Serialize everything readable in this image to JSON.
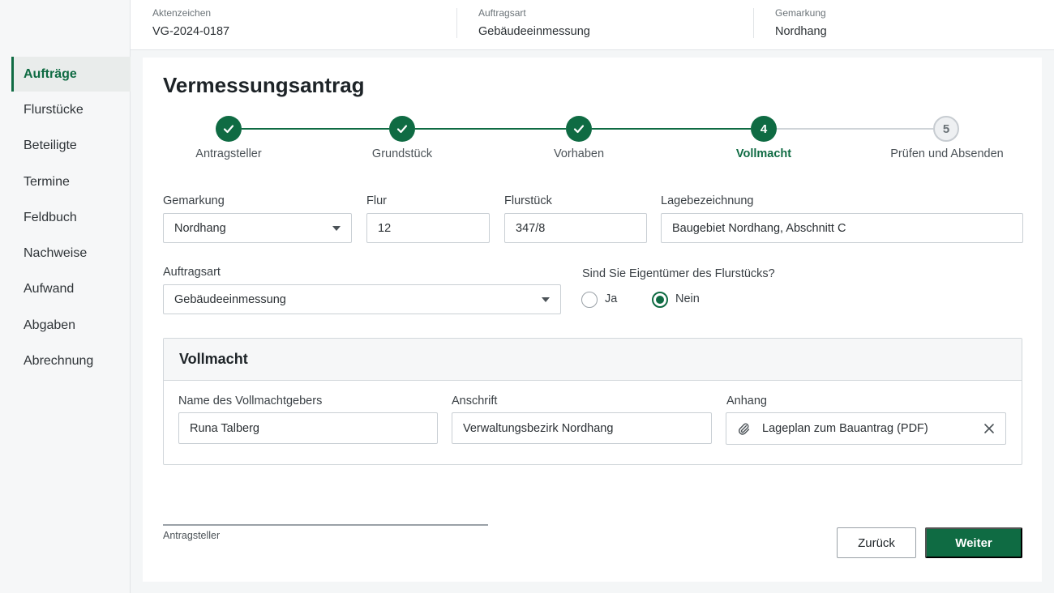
{
  "header": {
    "fields": [
      {
        "label": "Aktenzeichen",
        "value": "VG-2024-0187"
      },
      {
        "label": "Auftragsart",
        "value": "Gebäudeeinmessung"
      },
      {
        "label": "Gemarkung",
        "value": "Nordhang"
      }
    ]
  },
  "sidebar": {
    "items": [
      {
        "label": "Aufträge",
        "active": true
      },
      {
        "label": "Flurstücke"
      },
      {
        "label": "Beteiligte"
      },
      {
        "label": "Termine"
      },
      {
        "label": "Feldbuch"
      },
      {
        "label": "Nachweise"
      },
      {
        "label": "Aufwand"
      },
      {
        "label": "Abgaben"
      },
      {
        "label": "Abrechnung"
      }
    ]
  },
  "page": {
    "title": "Vermessungsantrag"
  },
  "stepper": {
    "current_step": 4,
    "steps": [
      {
        "label": "Antragsteller",
        "state": "done",
        "icon": "check-icon"
      },
      {
        "label": "Grundstück",
        "state": "done",
        "icon": "check-icon"
      },
      {
        "label": "Vorhaben",
        "state": "done",
        "icon": "check-icon"
      },
      {
        "label": "Vollmacht",
        "state": "current",
        "number": "4"
      },
      {
        "label": "Prüfen und Absenden",
        "state": "todo",
        "number": "5"
      }
    ]
  },
  "form": {
    "gemarkung": {
      "label": "Gemarkung",
      "value": "Nordhang"
    },
    "flur": {
      "label": "Flur",
      "value": "12"
    },
    "flurstueck": {
      "label": "Flurstück",
      "value": "347/8"
    },
    "lagebezeichnung": {
      "label": "Lagebezeichnung",
      "value": "Baugebiet Nordhang, Abschnitt C"
    },
    "auftragsart": {
      "label": "Auftragsart",
      "value": "Gebäudeeinmessung"
    },
    "eigentuemer": {
      "label": "Sind Sie Eigentümer des Flurstücks?",
      "options": [
        "Ja",
        "Nein"
      ],
      "selected": "Nein"
    }
  },
  "vollmacht": {
    "title": "Vollmacht",
    "name": {
      "label": "Name des Vollmachtgebers",
      "value": "Runa Talberg"
    },
    "anschrift": {
      "label": "Anschrift",
      "value": "Verwaltungsbezirk Nordhang"
    },
    "anhang": {
      "label": "Anhang",
      "value": "Lageplan zum Bauantrag (PDF)",
      "icon": "paperclip-icon",
      "remove_icon": "close-icon"
    }
  },
  "signature": {
    "label": "Antragsteller"
  },
  "actions": {
    "back_label": "Zurück",
    "next_label": "Weiter"
  },
  "colors": {
    "accent": "#0f6b43",
    "border": "#c9cfd4",
    "pending": "#cfd4d8"
  }
}
